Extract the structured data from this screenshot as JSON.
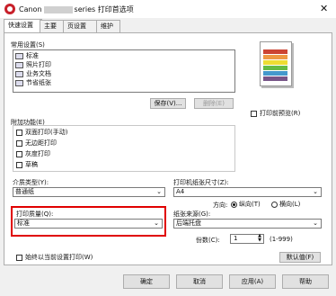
{
  "window": {
    "title_prefix": "Canon",
    "title_suffix": "series 打印首选项",
    "close_glyph": "✕"
  },
  "tabs": [
    "快速设置",
    "主要",
    "页设置",
    "维护"
  ],
  "common_settings": {
    "label": "常用设置(S)",
    "items": [
      "标准",
      "照片打印",
      "业务文档",
      "节省纸张"
    ],
    "save_button": "保存(V)...",
    "delete_button": "删除(E)"
  },
  "preview_checkbox": "打印前预览(R)",
  "additional_features": {
    "label": "附加功能(E)",
    "items": [
      "双面打印(手动)",
      "无边距打印",
      "灰度打印",
      "草稿"
    ]
  },
  "media_type": {
    "label": "介质类型(Y):",
    "value": "普通纸"
  },
  "paper_size": {
    "label": "打印机纸张尺寸(Z):",
    "value": "A4"
  },
  "orientation": {
    "label": "方向:",
    "portrait": "纵向(T)",
    "landscape": "横向(L)"
  },
  "print_quality": {
    "label": "打印质量(Q):",
    "value": "标准"
  },
  "paper_source": {
    "label": "纸张来源(G):",
    "value": "后端托盘"
  },
  "copies": {
    "label": "份数(C):",
    "value": "1",
    "range": "(1-999)"
  },
  "always_print_current": "始终以当前设置打印(W)",
  "defaults_button": "默认值(F)",
  "footer": {
    "ok": "确定",
    "cancel": "取消",
    "apply": "应用(A)",
    "help": "帮助"
  },
  "colors": {
    "highlight": "#e00000"
  }
}
